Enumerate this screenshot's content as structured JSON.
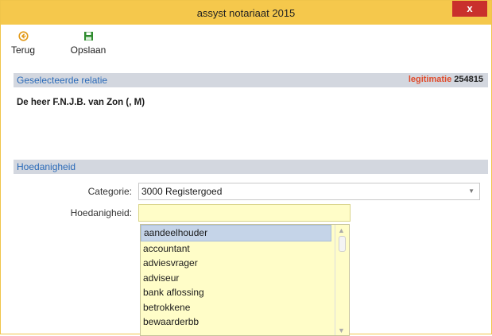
{
  "window": {
    "title": "assyst notariaat 2015",
    "close_label": "x"
  },
  "toolbar": {
    "back_label": "Terug",
    "save_label": "Opslaan",
    "back_icon": "back-arrow-circle-icon",
    "save_icon": "floppy-disk-icon"
  },
  "relation": {
    "section_label": "Geselecteerde relatie",
    "legitimatie_label": "legitimatie",
    "legitimatie_value": "254815",
    "name": "De heer F.N.J.B. van Zon (, M)"
  },
  "hoedanigheid": {
    "section_label": "Hoedanigheid",
    "categorie_label": "Categorie:",
    "categorie_value": "3000 Registergoed",
    "hoedanigheid_label": "Hoedanigheid:",
    "hoedanigheid_value": "",
    "options": [
      "aandeelhouder",
      "accountant",
      "adviesvrager",
      "adviseur",
      "bank aflossing",
      "betrokkene",
      "bewaarderbb"
    ],
    "selected_index": 0
  },
  "colors": {
    "titlebar": "#f5c84c",
    "close": "#c9302c",
    "section_bar": "#d3d7df",
    "section_text": "#2a6ab8",
    "legit": "#e04a2a",
    "field_yellow": "#fffdc8"
  }
}
